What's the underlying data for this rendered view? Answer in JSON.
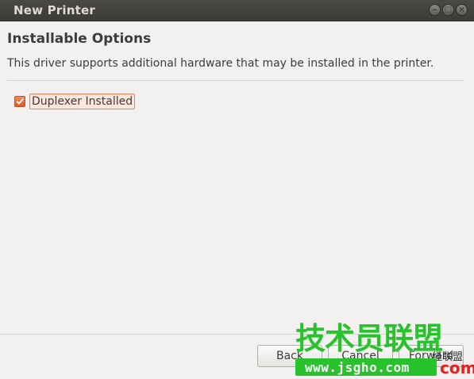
{
  "window": {
    "title": "New Printer",
    "controls": {
      "minimize": "–",
      "maximize": "□",
      "close": "×"
    }
  },
  "page": {
    "heading": "Installable Options",
    "description": "This driver supports additional hardware that may be installed in the printer."
  },
  "options": [
    {
      "label": "Duplexer Installed",
      "checked": true,
      "focused": true
    }
  ],
  "footer": {
    "back_label": "Back",
    "cancel_label": "Cancel",
    "forward_label": "Forward"
  },
  "watermark": {
    "title": "技术员联盟",
    "url": "www.jsgho.com",
    "com": "com",
    "sub": "经联盟"
  },
  "colors": {
    "titlebar": "#3c3b37",
    "accent": "#dd4814",
    "watermark_green": "#27c22c"
  }
}
